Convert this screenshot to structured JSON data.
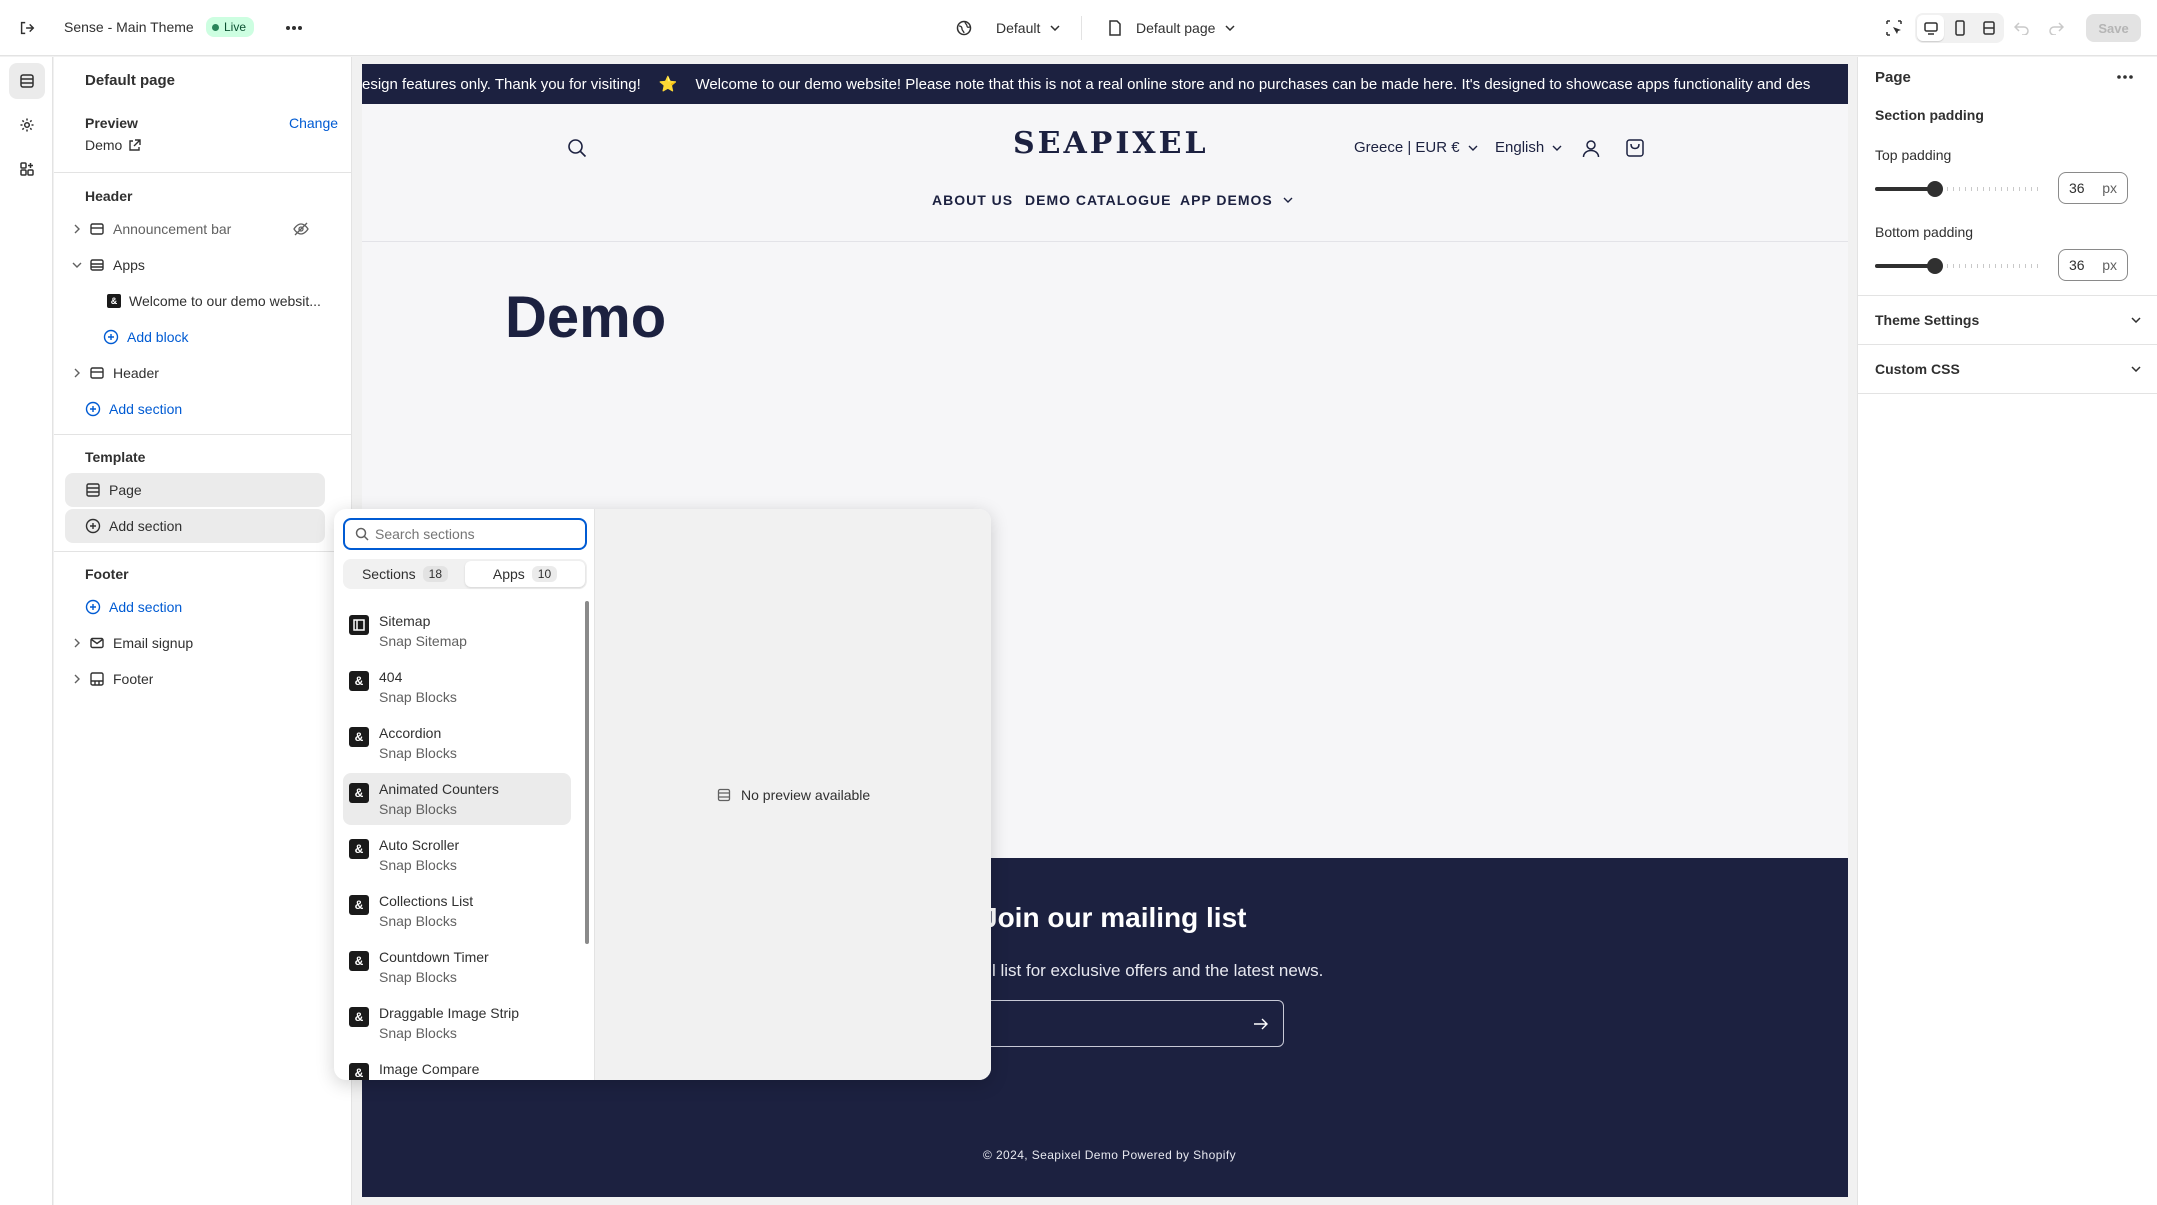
{
  "topbar": {
    "theme_name": "Sense - Main Theme",
    "live_label": "Live",
    "context_selector": "Default",
    "page_selector": "Default page",
    "save_label": "Save"
  },
  "left_panel": {
    "page_heading": "Default page",
    "preview": {
      "label": "Preview",
      "change_link": "Change",
      "value": "Demo"
    },
    "header_group": {
      "title": "Header",
      "items": [
        {
          "label": "Announcement bar"
        },
        {
          "label": "Apps"
        },
        {
          "label": "Welcome to our demo websit..."
        },
        {
          "label": "Add block"
        },
        {
          "label": "Header"
        },
        {
          "label": "Add section"
        }
      ]
    },
    "template_group": {
      "title": "Template",
      "items": [
        {
          "label": "Page"
        },
        {
          "label": "Add section"
        }
      ]
    },
    "footer_group": {
      "title": "Footer",
      "items": [
        {
          "label": "Add section"
        },
        {
          "label": "Email signup"
        },
        {
          "label": "Footer"
        }
      ]
    }
  },
  "preview": {
    "announcement_left": "esign features only. Thank you for visiting!",
    "announcement_star": "⭐",
    "announcement_right": "Welcome to our demo website! Please note that this is not a real online store and no purchases can be made here. It's designed to showcase apps functionality and des",
    "logo": "SEAPIXEL",
    "country": "Greece | EUR €",
    "language": "English",
    "nav": [
      "ABOUT US",
      "DEMO CATALOGUE",
      "APP DEMOS"
    ],
    "page_title": "Demo",
    "mailing_title": "Join our mailing list",
    "mailing_text": "l list for exclusive offers and the latest news.",
    "copyright": "© 2024, Seapixel Demo Powered by Shopify"
  },
  "picker": {
    "search_placeholder": "Search sections",
    "tabs": [
      {
        "label": "Sections",
        "count": "18"
      },
      {
        "label": "Apps",
        "count": "10"
      }
    ],
    "items": [
      {
        "title": "Sitemap",
        "subtitle": "Snap Sitemap"
      },
      {
        "title": "404",
        "subtitle": "Snap Blocks"
      },
      {
        "title": "Accordion",
        "subtitle": "Snap Blocks"
      },
      {
        "title": "Animated Counters",
        "subtitle": "Snap Blocks"
      },
      {
        "title": "Auto Scroller",
        "subtitle": "Snap Blocks"
      },
      {
        "title": "Collections List",
        "subtitle": "Snap Blocks"
      },
      {
        "title": "Countdown Timer",
        "subtitle": "Snap Blocks"
      },
      {
        "title": "Draggable Image Strip",
        "subtitle": "Snap Blocks"
      },
      {
        "title": "Image Compare",
        "subtitle": ""
      }
    ],
    "no_preview": "No preview available"
  },
  "right_panel": {
    "title": "Page",
    "section_padding": "Section padding",
    "top_padding": {
      "label": "Top padding",
      "value": "36",
      "unit": "px",
      "fraction": 0.36
    },
    "bottom_padding": {
      "label": "Bottom padding",
      "value": "36",
      "unit": "px",
      "fraction": 0.36
    },
    "theme_settings": "Theme Settings",
    "custom_css": "Custom CSS"
  }
}
